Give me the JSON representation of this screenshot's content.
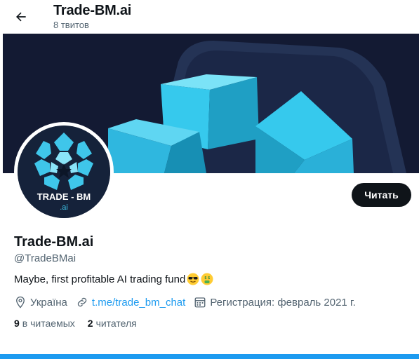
{
  "header": {
    "title": "Trade-BM.ai",
    "tweets_count": "8 твитов"
  },
  "profile": {
    "name": "Trade-BM.ai",
    "handle": "@TradeBMai",
    "bio": "Maybe, first profitable AI trading fund",
    "follow_button": "Читать",
    "avatar_text_1": "TRADE - BM",
    "avatar_text_2": ".ai",
    "location": "Україна",
    "link": "t.me/trade_bm_chat",
    "joined": "Регистрация: февраль 2021 г."
  },
  "stats": {
    "following_count": "9",
    "following_label": "в читаемых",
    "followers_count": "2",
    "followers_label": "читателя"
  },
  "colors": {
    "accent": "#1d9bf0",
    "banner_bg": "#131a33",
    "cube_light": "#35c8ec",
    "button_bg": "#0f1419"
  },
  "icons": [
    "back-arrow-icon",
    "location-pin-icon",
    "link-icon",
    "calendar-icon",
    "sunglasses-emoji-icon",
    "money-mouth-emoji-icon"
  ]
}
